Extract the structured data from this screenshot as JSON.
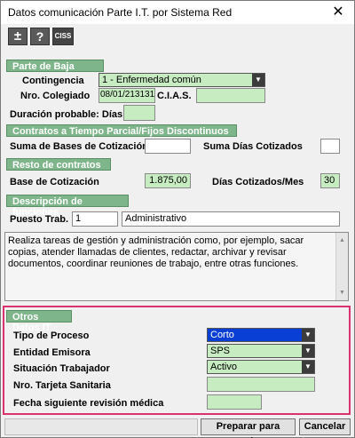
{
  "window": {
    "title": "Datos comunicación Parte I.T. por Sistema Red",
    "close_glyph": "✕"
  },
  "toolbar": {
    "plusminus": "±",
    "help": "?",
    "ciss": "CISS"
  },
  "parte_baja": {
    "section_label": "Parte de Baja",
    "contingencia_label": "Contingencia",
    "contingencia_value": "1 - Enfermedad común",
    "nro_colegiado_label": "Nro. Colegiado",
    "nro_colegiado_value": "08/01/213131",
    "cias_label": "C.I.A.S.",
    "cias_value": "",
    "duracion_label": "Duración probable: Días",
    "duracion_value": ""
  },
  "contratos_tiempo_parcial": {
    "section_label": "Contratos a Tiempo Parcial/Fijos Discontinuos",
    "suma_bases_label": "Suma de Bases de Cotización",
    "suma_bases_value": "",
    "suma_dias_label": "Suma Días Cotizados",
    "suma_dias_value": ""
  },
  "resto_contratos": {
    "section_label": "Resto de contratos",
    "base_cotizacion_label": "Base de Cotización",
    "base_cotizacion_value": "1.875,00",
    "dias_cotizados_label": "Días Cotizados/Mes",
    "dias_cotizados_value": "30"
  },
  "descripcion_funciones": {
    "section_label": "Descripción de funciones",
    "puesto_label": "Puesto Trab.",
    "puesto_code": "1",
    "puesto_name": "Administrativo",
    "description": "Realiza tareas de gestión y administración como, por ejemplo, sacar copias, atender llamadas de clientes, redactar, archivar y revisar documentos, coordinar reuniones de trabajo, entre otras funciones."
  },
  "otros_datos": {
    "section_label": "Otros Datos IT",
    "tipo_proceso_label": "Tipo de Proceso",
    "tipo_proceso_value": "Corto",
    "entidad_label": "Entidad Emisora",
    "entidad_value": "SPS",
    "situacion_label": "Situación Trabajador",
    "situacion_value": "Activo",
    "tarjeta_label": "Nro. Tarjeta Sanitaria",
    "tarjeta_value": "",
    "fecha_label": "Fecha siguiente revisión médica",
    "fecha_value": ""
  },
  "footer": {
    "preparar_label": "Preparar para enviar",
    "cancelar_label": "Cancelar"
  },
  "colors": {
    "section_green": "#7fb58b",
    "field_green": "#c8ecc2",
    "highlight": "#d8336f",
    "selected_blue": "#0a3fd6"
  }
}
